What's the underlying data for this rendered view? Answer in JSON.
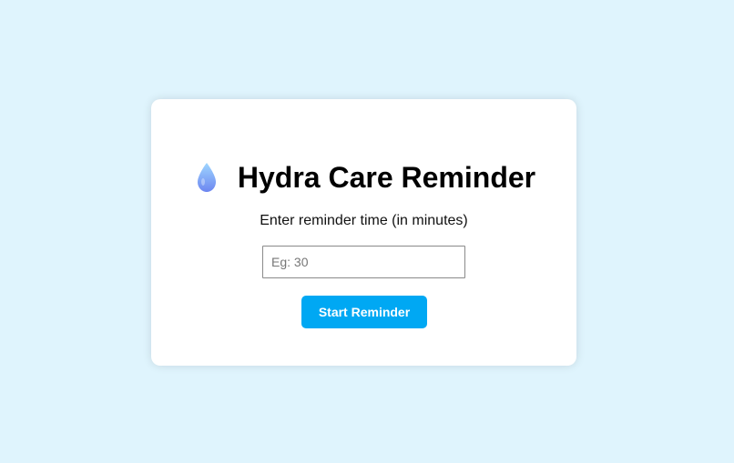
{
  "card": {
    "title": "Hydra Care Reminder",
    "title_icon": "water-drop-icon",
    "label": "Enter reminder time (in minutes)",
    "input": {
      "value": "",
      "placeholder": "Eg: 30"
    },
    "start_button_label": "Start Reminder"
  },
  "colors": {
    "page_background": "#dff4fd",
    "card_background": "#ffffff",
    "button_background": "#00a8f3",
    "button_text": "#ffffff",
    "drop_top": "#8ec6ff",
    "drop_bottom": "#6f8cf2"
  }
}
